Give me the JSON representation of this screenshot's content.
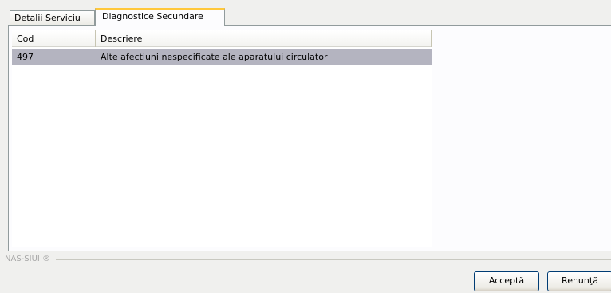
{
  "tabs": [
    {
      "label": "Detalii Serviciu",
      "active": false
    },
    {
      "label": "Diagnostice Secundare",
      "active": true
    }
  ],
  "grid": {
    "columns": [
      "Cod",
      "Descriere"
    ],
    "rows": [
      {
        "cod": "497",
        "descriere": "Alte afectiuni nespecificate ale aparatului circulator",
        "selected": true
      }
    ]
  },
  "footer": {
    "group_label": "NAS-SIUI ®"
  },
  "buttons": {
    "accept": "Acceptă",
    "cancel": "Renunţă"
  },
  "colors": {
    "active_tab_accent": "#ffc83c",
    "selected_row": "#b4b4c0",
    "button_border": "#003c74"
  }
}
